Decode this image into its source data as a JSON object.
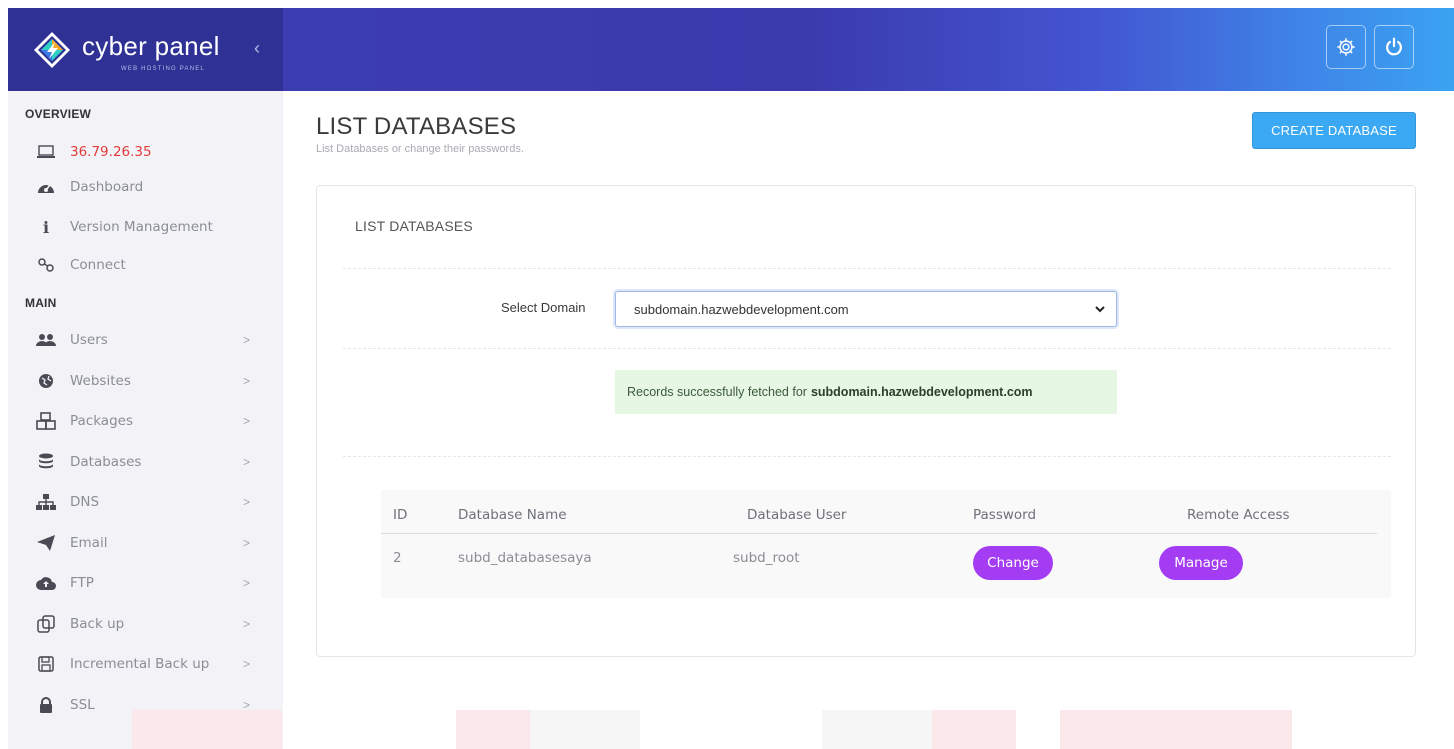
{
  "header": {
    "brand": "cyber panel",
    "brand_sub": "WEB HOSTING PANEL",
    "collapse_icon": "chevron-left-icon",
    "buttons": [
      {
        "icon": "gear-icon"
      },
      {
        "icon": "power-icon"
      }
    ]
  },
  "sidebar": {
    "overview_title": "OVERVIEW",
    "main_title": "MAIN",
    "ip": "36.79.26.35",
    "overview_items": [
      {
        "label": "Dashboard",
        "icon": "dashboard-icon"
      },
      {
        "label": "Version Management",
        "icon": "info-icon"
      },
      {
        "label": "Connect",
        "icon": "connect-icon"
      }
    ],
    "main_items": [
      {
        "label": "Users",
        "icon": "users-icon"
      },
      {
        "label": "Websites",
        "icon": "globe-icon"
      },
      {
        "label": "Packages",
        "icon": "packages-icon"
      },
      {
        "label": "Databases",
        "icon": "database-icon"
      },
      {
        "label": "DNS",
        "icon": "sitemap-icon"
      },
      {
        "label": "Email",
        "icon": "paper-plane-icon"
      },
      {
        "label": "FTP",
        "icon": "cloud-upload-icon"
      },
      {
        "label": "Back up",
        "icon": "backup-icon"
      },
      {
        "label": "Incremental Back up",
        "icon": "save-icon"
      },
      {
        "label": "SSL",
        "icon": "lock-icon"
      }
    ],
    "chevron": ">"
  },
  "main": {
    "title": "LIST DATABASES",
    "subtitle": "List Databases or change their passwords.",
    "create_button": "CREATE DATABASE",
    "card_title": "LIST DATABASES",
    "select_label": "Select Domain",
    "selected_domain": "subdomain.hazwebdevelopment.com",
    "alert_prefix": "Records successfully fetched for",
    "alert_domain": "subdomain.hazwebdevelopment.com",
    "table": {
      "headers": [
        "ID",
        "Database Name",
        "Database User",
        "Password",
        "Remote Access"
      ],
      "rows": [
        {
          "id": "2",
          "name": "subd_databasesaya",
          "user": "subd_root",
          "password_action": "Change",
          "remote_action": "Manage"
        }
      ]
    }
  },
  "colors": {
    "header_start": "#3d3fb3",
    "header_end": "#3aa3f2",
    "accent_blue": "#3aa8f2",
    "action_purple": "#a33cf2",
    "ip_red": "#e23b3b",
    "alert_bg": "#e6f7e3"
  }
}
